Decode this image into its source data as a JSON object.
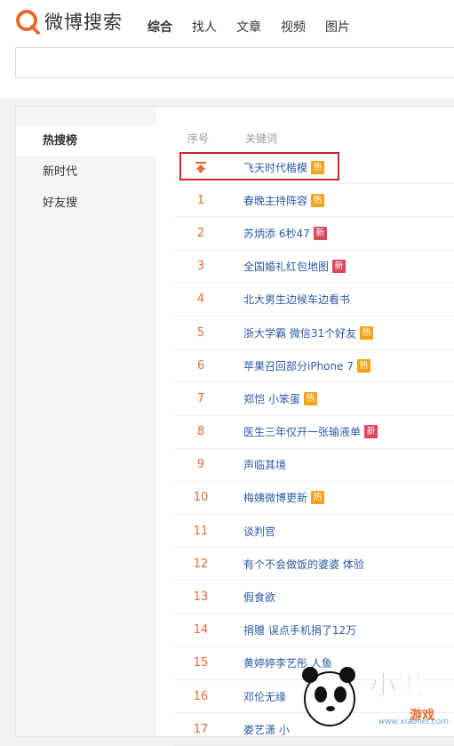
{
  "header": {
    "logo_text": "微博搜索",
    "nav": [
      "综合",
      "找人",
      "文章",
      "视频",
      "图片"
    ]
  },
  "search": {
    "value": "",
    "placeholder": ""
  },
  "sidebar": {
    "items": [
      {
        "label": "热搜榜"
      },
      {
        "label": "新时代"
      },
      {
        "label": "好友搜"
      }
    ]
  },
  "table": {
    "col_no": "序号",
    "col_keyword": "关键词",
    "top_item": {
      "keyword": "飞天时代楷模",
      "badge": "热"
    },
    "rows": [
      {
        "rank": "1",
        "keyword": "春晚主持阵容",
        "badge": "热"
      },
      {
        "rank": "2",
        "keyword": "苏炳添 6秒47",
        "badge": "新"
      },
      {
        "rank": "3",
        "keyword": "全国婚礼红包地图",
        "badge": "新"
      },
      {
        "rank": "4",
        "keyword": "北大男生边候车边看书",
        "badge": ""
      },
      {
        "rank": "5",
        "keyword": "浙大学霸 微信31个好友",
        "badge": "热"
      },
      {
        "rank": "6",
        "keyword": "苹果召回部分iPhone 7",
        "badge": "热"
      },
      {
        "rank": "7",
        "keyword": "郑恺 小笨蛋",
        "badge": "热"
      },
      {
        "rank": "8",
        "keyword": "医生三年仅开一张输液单",
        "badge": "新"
      },
      {
        "rank": "9",
        "keyword": "声临其境",
        "badge": ""
      },
      {
        "rank": "10",
        "keyword": "梅姨微博更新",
        "badge": "热"
      },
      {
        "rank": "11",
        "keyword": "谈判官",
        "badge": ""
      },
      {
        "rank": "12",
        "keyword": "有个不会做饭的婆婆 体验",
        "badge": ""
      },
      {
        "rank": "13",
        "keyword": "假食欲",
        "badge": ""
      },
      {
        "rank": "14",
        "keyword": "捐赠 误点手机捐了12万",
        "badge": ""
      },
      {
        "rank": "15",
        "keyword": "黄婷婷李艺彤 人鱼",
        "badge": ""
      },
      {
        "rank": "16",
        "keyword": "邓伦无缘",
        "badge": ""
      },
      {
        "rank": "17",
        "keyword": "娄艺潇 小",
        "badge": ""
      }
    ]
  },
  "watermark": {
    "site": "www.xiaohei.com"
  },
  "colors": {
    "accent": "#e8692f",
    "link": "#2b5aa2",
    "hot": "#f2a31a",
    "new": "#e0435d",
    "highlight": "#d0262b"
  }
}
